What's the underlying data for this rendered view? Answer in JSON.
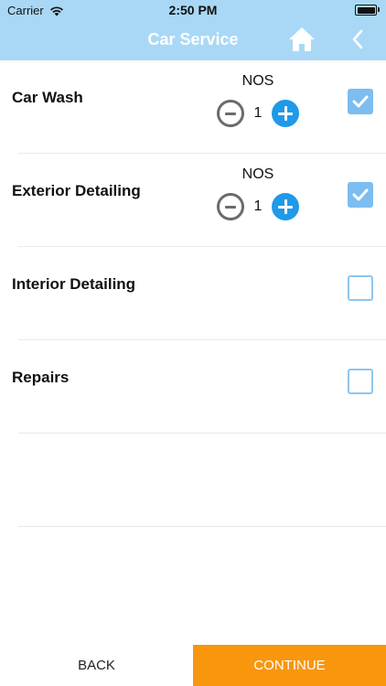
{
  "status_bar": {
    "carrier": "Carrier",
    "time": "2:50 PM"
  },
  "header": {
    "title": "Car Service",
    "home_icon": "home-icon",
    "back_icon": "chevron-left-icon",
    "background_color": "#a9d8f6"
  },
  "services": [
    {
      "name": "Car Wash",
      "unit": "NOS",
      "quantity": "1",
      "checked": true
    },
    {
      "name": "Exterior Detailing",
      "unit": "NOS",
      "quantity": "1",
      "checked": true
    },
    {
      "name": "Interior Detailing",
      "checked": false
    },
    {
      "name": "Repairs",
      "checked": false
    }
  ],
  "footer": {
    "back_label": "BACK",
    "continue_label": "CONTINUE",
    "continue_color": "#f8960e"
  }
}
